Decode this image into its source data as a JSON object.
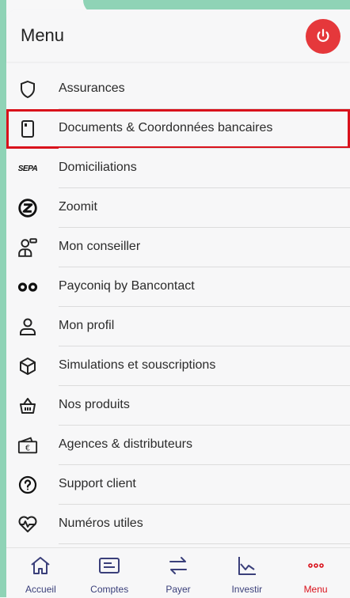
{
  "header": {
    "title": "Menu",
    "power_button_icon": "power-icon",
    "accent": "#e5383b"
  },
  "menu": {
    "items": [
      {
        "label": "Assurances",
        "icon": "shield-icon"
      },
      {
        "label": "Documents & Coordonnées bancaires",
        "icon": "document-icon",
        "highlighted": true
      },
      {
        "label": "Domiciliations",
        "icon": "scpa-icon",
        "icon_text": "SEPA"
      },
      {
        "label": "Zoomit",
        "icon": "zoomit-icon"
      },
      {
        "label": "Mon conseiller",
        "icon": "advisor-icon"
      },
      {
        "label": "Payconiq by Bancontact",
        "icon": "payconiq-icon"
      },
      {
        "label": "Mon profil",
        "icon": "profile-icon"
      },
      {
        "label": "Simulations et souscriptions",
        "icon": "cube-icon"
      },
      {
        "label": "Nos produits",
        "icon": "basket-icon"
      },
      {
        "label": "Agences & distributeurs",
        "icon": "wallet-icon"
      },
      {
        "label": "Support client",
        "icon": "question-icon"
      },
      {
        "label": "Numéros utiles",
        "icon": "heartbeat-icon"
      }
    ]
  },
  "bottom_nav": {
    "items": [
      {
        "label": "Accueil",
        "icon": "home-icon"
      },
      {
        "label": "Comptes",
        "icon": "card-icon"
      },
      {
        "label": "Payer",
        "icon": "transfer-icon"
      },
      {
        "label": "Investir",
        "icon": "chart-icon"
      },
      {
        "label": "Menu",
        "icon": "more-dots-icon",
        "active": true
      }
    ]
  },
  "colors": {
    "highlight_border": "#d9111b",
    "nav_text": "#3a3f7a",
    "active_nav": "#d9111b",
    "stripe": "#8fd3b6"
  }
}
